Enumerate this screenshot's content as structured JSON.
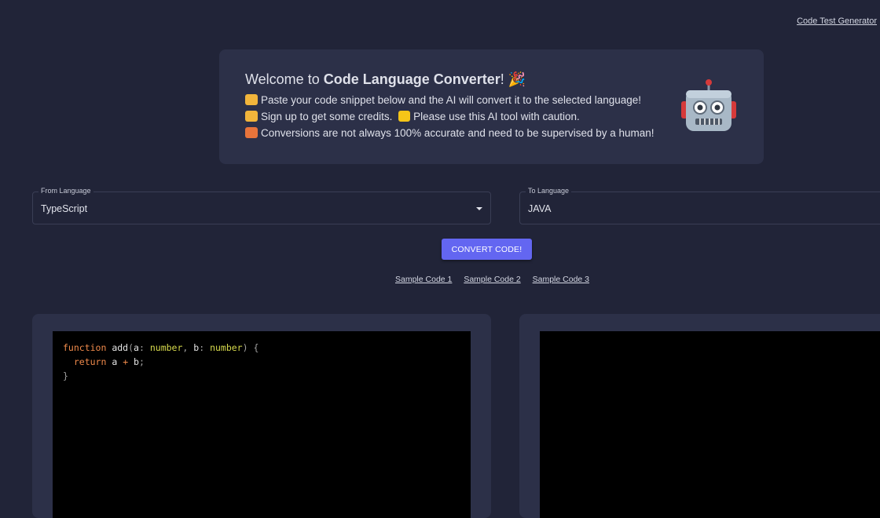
{
  "header": {
    "link_label": "Code Test Generator"
  },
  "welcome": {
    "title_prefix": "Welcome to ",
    "title_brand": "Code Language Converter",
    "title_suffix": "! 🎉",
    "lines": [
      {
        "icon": "pointing-down-emoji",
        "text": "Paste your code snippet below and the AI will convert it to the selected language!"
      },
      {
        "icon": "pointing-right-emoji",
        "text": "Sign up to get some credits."
      },
      {
        "icon": "repeat-emoji",
        "text": "Conversions are not always 100% accurate and need to be supervised by a human!"
      }
    ],
    "warning_icon": "warning-emoji",
    "warning_text": "Please use this AI tool with caution.",
    "robot_icon": "robot-emoji"
  },
  "from_language": {
    "label": "From Language",
    "value": "TypeScript"
  },
  "to_language": {
    "label": "To Language",
    "value": "JAVA"
  },
  "convert_button": {
    "label": "CONVERT CODE!"
  },
  "samples": [
    "Sample Code 1",
    "Sample Code 2",
    "Sample Code 3"
  ],
  "source_code": {
    "lines": [
      "function add(a: number, b: number) {",
      "  return a + b;",
      "}"
    ]
  },
  "output_code": {
    "lines": []
  },
  "colors": {
    "background": "#212438",
    "card": "#2c3048",
    "accent": "#6366f1",
    "editor": "#000000"
  }
}
